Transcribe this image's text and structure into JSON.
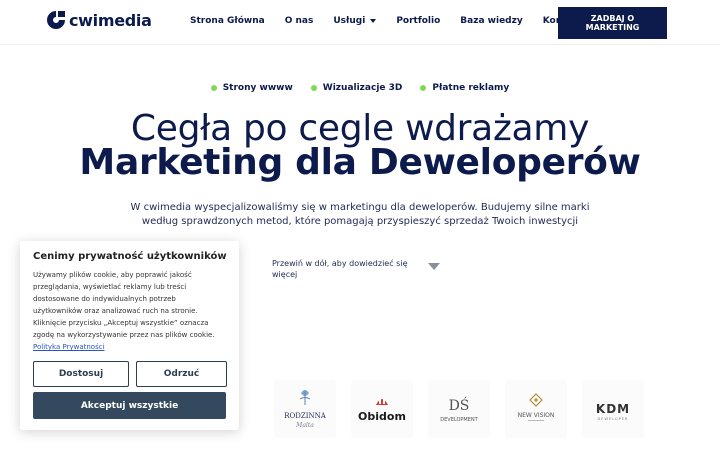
{
  "brand": {
    "name": "cwimedia"
  },
  "nav": {
    "items": [
      {
        "label": "Strona Główna"
      },
      {
        "label": "O nas"
      },
      {
        "label": "Usługi",
        "has_caret": true
      },
      {
        "label": "Portfolio"
      },
      {
        "label": "Baza wiedzy"
      },
      {
        "label": "Kontakt"
      }
    ],
    "cta_label": "ZADBAJ O MARKETING"
  },
  "hero": {
    "tags": [
      "Strony wwww",
      "Wizualizacje 3D",
      "Płatne reklamy"
    ],
    "title_line1": "Cegła po cegle wdrażamy",
    "title_line2": "Marketing dla Deweloperów",
    "lead": "W cwimedia wyspecjalizowaliśmy się w marketingu dla deweloperów. Budujemy silne marki według sprawdzonych metod, które pomagają przyspieszyć sprzedaż Twoich inwestycji",
    "scroll_hint": "Przewiń w dół, aby dowiedzieć się więcej"
  },
  "partners": [
    {
      "name": "RODZINNA",
      "sub": "Malta"
    },
    {
      "name": "Obidom"
    },
    {
      "name": "DEVELOPMENT",
      "mark": "DŚ"
    },
    {
      "name": "NEW VISION"
    },
    {
      "name": "KDM",
      "sub": "DEWELOPER"
    }
  ],
  "cookie": {
    "title": "Cenimy prywatność użytkowników",
    "body": "Używamy plików cookie, aby poprawić jakość przeglądania, wyświetlać reklamy lub treści dostosowane do indywidualnych potrzeb użytkowników oraz analizować ruch na stronie. Kliknięcie przycisku „Akceptuj wszystkie” oznacza zgodę na wykorzystywanie przez nas plików cookie.",
    "policy_link": "Polityka Prywatności",
    "customize_label": "Dostosuj",
    "reject_label": "Odrzuć",
    "accept_label": "Akceptuj wszystkie"
  },
  "colors": {
    "navy": "#0d1b4c",
    "accent_green": "#7ed957",
    "cookie_button": "#34495e",
    "link": "#2a54c8"
  }
}
